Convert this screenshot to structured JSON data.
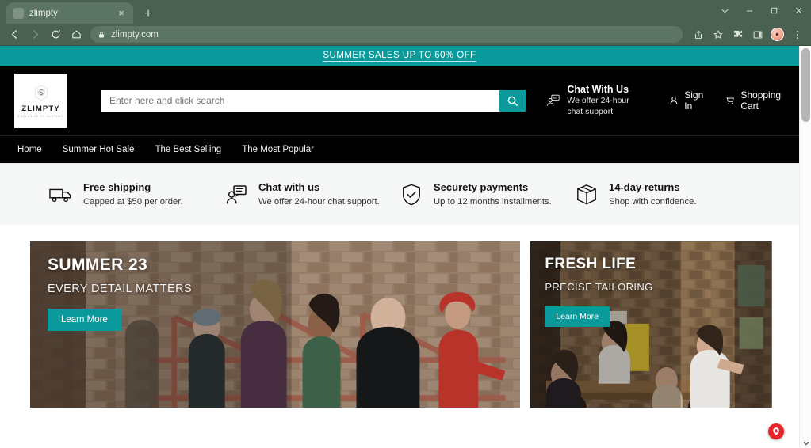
{
  "browser": {
    "tab": {
      "title": "zlimpty",
      "close_label": "×",
      "favicon": "site-favicon"
    },
    "new_tab_label": "+",
    "window_controls": [
      "chevron-down",
      "minimize",
      "maximize",
      "close"
    ],
    "nav": {
      "back": "back-arrow",
      "forward": "forward-arrow",
      "reload": "reload",
      "home": "home"
    },
    "omnibox": {
      "lock": "lock-icon",
      "url": "zlimpty.com"
    },
    "toolbar_icons": [
      "share-icon",
      "bookmark-star-icon",
      "extensions-puzzle-icon",
      "side-panel-icon",
      "profile-avatar",
      "three-dot-menu-icon"
    ],
    "avatar_initial": "●"
  },
  "colors": {
    "teal": "#0b9a9c",
    "header_black": "#000000",
    "chrome_green": "#4a6152",
    "feature_strip": "#f6f7f7",
    "badge_red": "#e8252a"
  },
  "promo": {
    "text": "SUMMER SALES UP TO 60% OFF"
  },
  "header": {
    "logo": {
      "name": "ZLIMPTY",
      "tagline": "EXCLUSIVE TO CLOTHES",
      "mark": "monogram-emblem"
    },
    "search": {
      "placeholder": "Enter here and click search",
      "value": "",
      "button_icon": "search-icon"
    },
    "chat": {
      "icon": "chat-support-icon",
      "title": "Chat With Us",
      "subtitle": "We offer 24-hour chat support"
    },
    "signin": {
      "icon": "user-icon",
      "label": "Sign In"
    },
    "cart": {
      "icon": "shopping-cart-icon",
      "label": "Shopping Cart"
    }
  },
  "nav": {
    "items": [
      {
        "label": "Home"
      },
      {
        "label": "Summer Hot Sale"
      },
      {
        "label": "The Best Selling"
      },
      {
        "label": "The Most Popular"
      }
    ]
  },
  "features": [
    {
      "icon": "truck-icon",
      "title": "Free shipping",
      "desc": "Capped at $50 per order."
    },
    {
      "icon": "chat-support-icon",
      "title": "Chat with us",
      "desc": "We offer 24-hour chat support."
    },
    {
      "icon": "shield-check-icon",
      "title": "Securety payments",
      "desc": "Up to 12 months installments."
    },
    {
      "icon": "box-icon",
      "title": "14-day returns",
      "desc": "Shop with confidence."
    }
  ],
  "heroes": [
    {
      "title": "SUMMER 23",
      "subtitle": "EVERY DETAIL MATTERS",
      "button": "Learn More",
      "image": "group-of-friends-brick-wall-scaffolding"
    },
    {
      "title": "FRESH LIFE",
      "subtitle": "PRECISE TAILORING",
      "button": "Learn More",
      "image": "friends-outdoor-market-stone-wall"
    }
  ],
  "floating_badge": {
    "icon": "location-person-pin-icon"
  }
}
